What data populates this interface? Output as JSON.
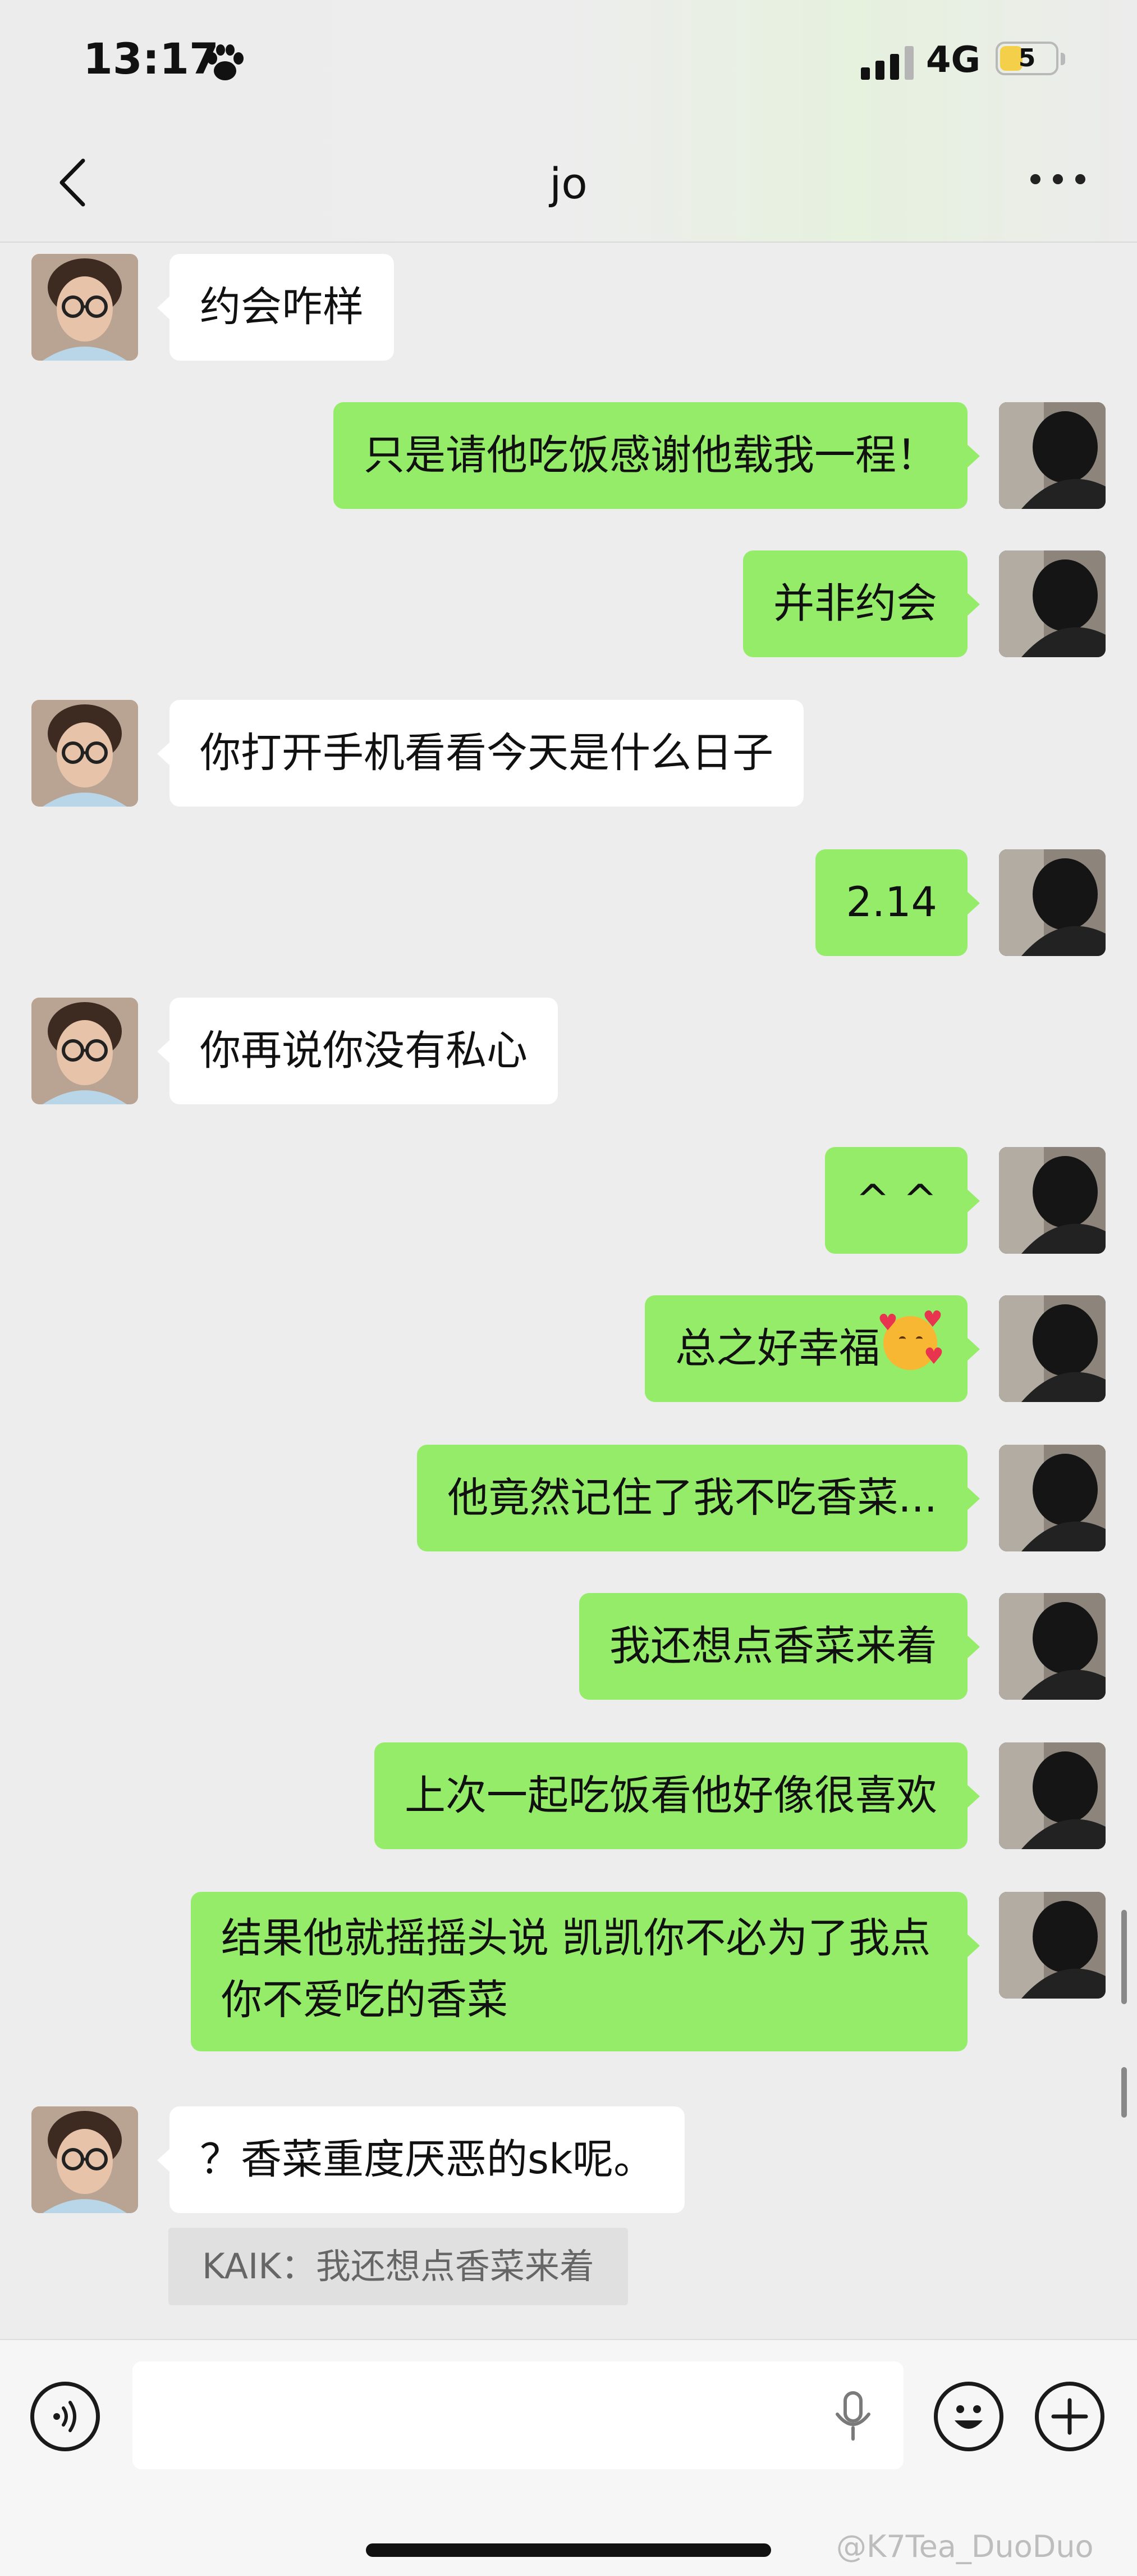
{
  "status_bar": {
    "time": "13:17",
    "network": "4G",
    "battery": "5"
  },
  "nav": {
    "title": "jo"
  },
  "messages": [
    {
      "side": "in",
      "text": "约会咋样"
    },
    {
      "side": "out",
      "text": "只是请他吃饭感谢他载我一程！"
    },
    {
      "side": "out",
      "text": "并非约会"
    },
    {
      "side": "in",
      "text": "你打开手机看看今天是什么日子"
    },
    {
      "side": "out",
      "text": "2.14"
    },
    {
      "side": "in",
      "text": "你再说你没有私心"
    },
    {
      "side": "out",
      "text": "^ ^"
    },
    {
      "side": "out",
      "text": "总之好幸福"
    },
    {
      "side": "out",
      "text": "他竟然记住了我不吃香菜..."
    },
    {
      "side": "out",
      "text": "我还想点香菜来着"
    },
    {
      "side": "out",
      "text": "上次一起吃饭看他好像很喜欢"
    },
    {
      "side": "out",
      "text": "结果他就摇摇头说 凯凯你不必为了我点你不爱吃的香菜"
    },
    {
      "side": "in",
      "text": "？香菜重度厌恶的sk呢。"
    }
  ],
  "quote": {
    "text": "KAIK：我还想点香菜来着"
  },
  "watermark": "@K7Tea_DuoDuo",
  "colors": {
    "outgoing_bubble": "#95ec69",
    "incoming_bubble": "#ffffff",
    "background": "#ededed"
  }
}
